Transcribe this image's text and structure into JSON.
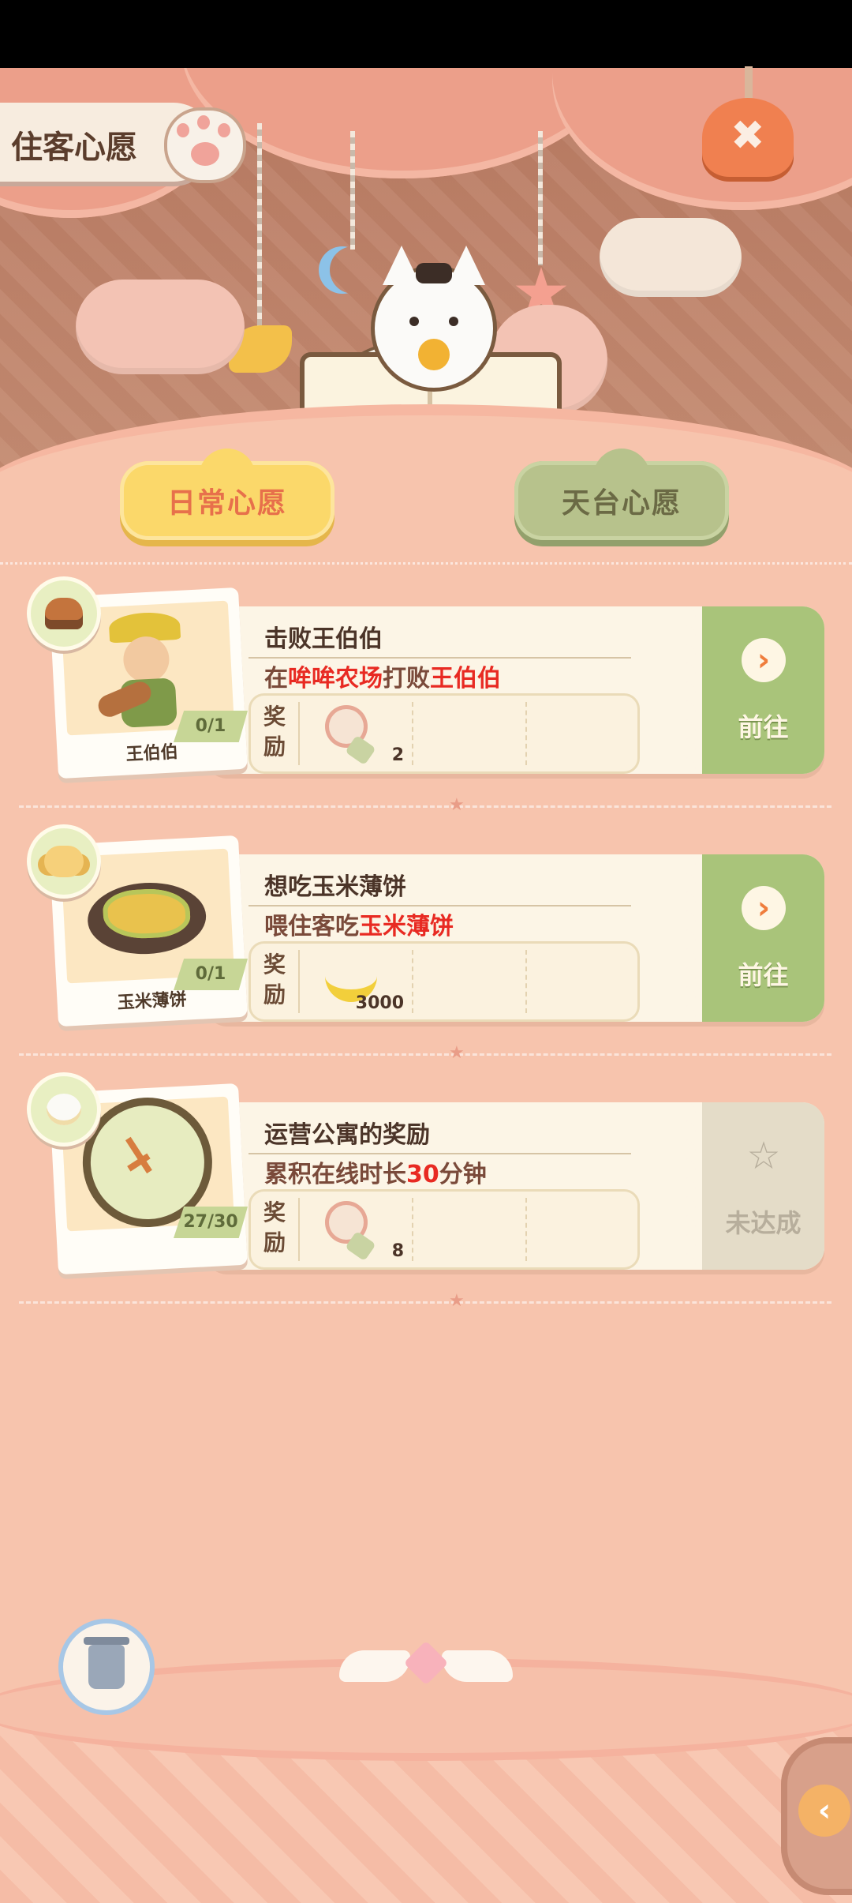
{
  "header": {
    "title": "住客心愿",
    "close_icon": "close-icon"
  },
  "tabs": [
    {
      "label": "日常心愿",
      "active": true
    },
    {
      "label": "天台心愿",
      "active": false
    }
  ],
  "wishes": [
    {
      "title": "击败王伯伯",
      "desc_parts": [
        "在",
        "哞哞农场",
        "打败",
        "王伯伯"
      ],
      "portrait_label": "王伯伯",
      "progress": "0/1",
      "reward_label": "奖励",
      "reward": {
        "icon": "paw-bouquet-icon",
        "count": "2"
      },
      "action_label": "前往",
      "status": "go",
      "badge_icon": "burger-icon"
    },
    {
      "title": "想吃玉米薄饼",
      "desc_parts": [
        "喂住客吃",
        "玉米薄饼"
      ],
      "portrait_label": "玉米薄饼",
      "progress": "0/1",
      "reward_label": "奖励",
      "reward": {
        "icon": "banana-icon",
        "count": "3000"
      },
      "action_label": "前往",
      "status": "go",
      "badge_icon": "dog-icon"
    },
    {
      "title": "运营公寓的奖励",
      "desc_parts": [
        "累积在线时长",
        "30",
        "分钟"
      ],
      "portrait_label": "",
      "progress": "27/30",
      "reward_label": "奖励",
      "reward": {
        "icon": "paw-bouquet-icon",
        "count": "8"
      },
      "action_label": "未达成",
      "status": "locked",
      "badge_icon": "chick-icon"
    }
  ],
  "colors": {
    "accent_orange": "#ef7d3c",
    "highlight_red": "#e82a22",
    "go_green": "#a9c47a",
    "tab_yellow": "#fbd86a"
  }
}
